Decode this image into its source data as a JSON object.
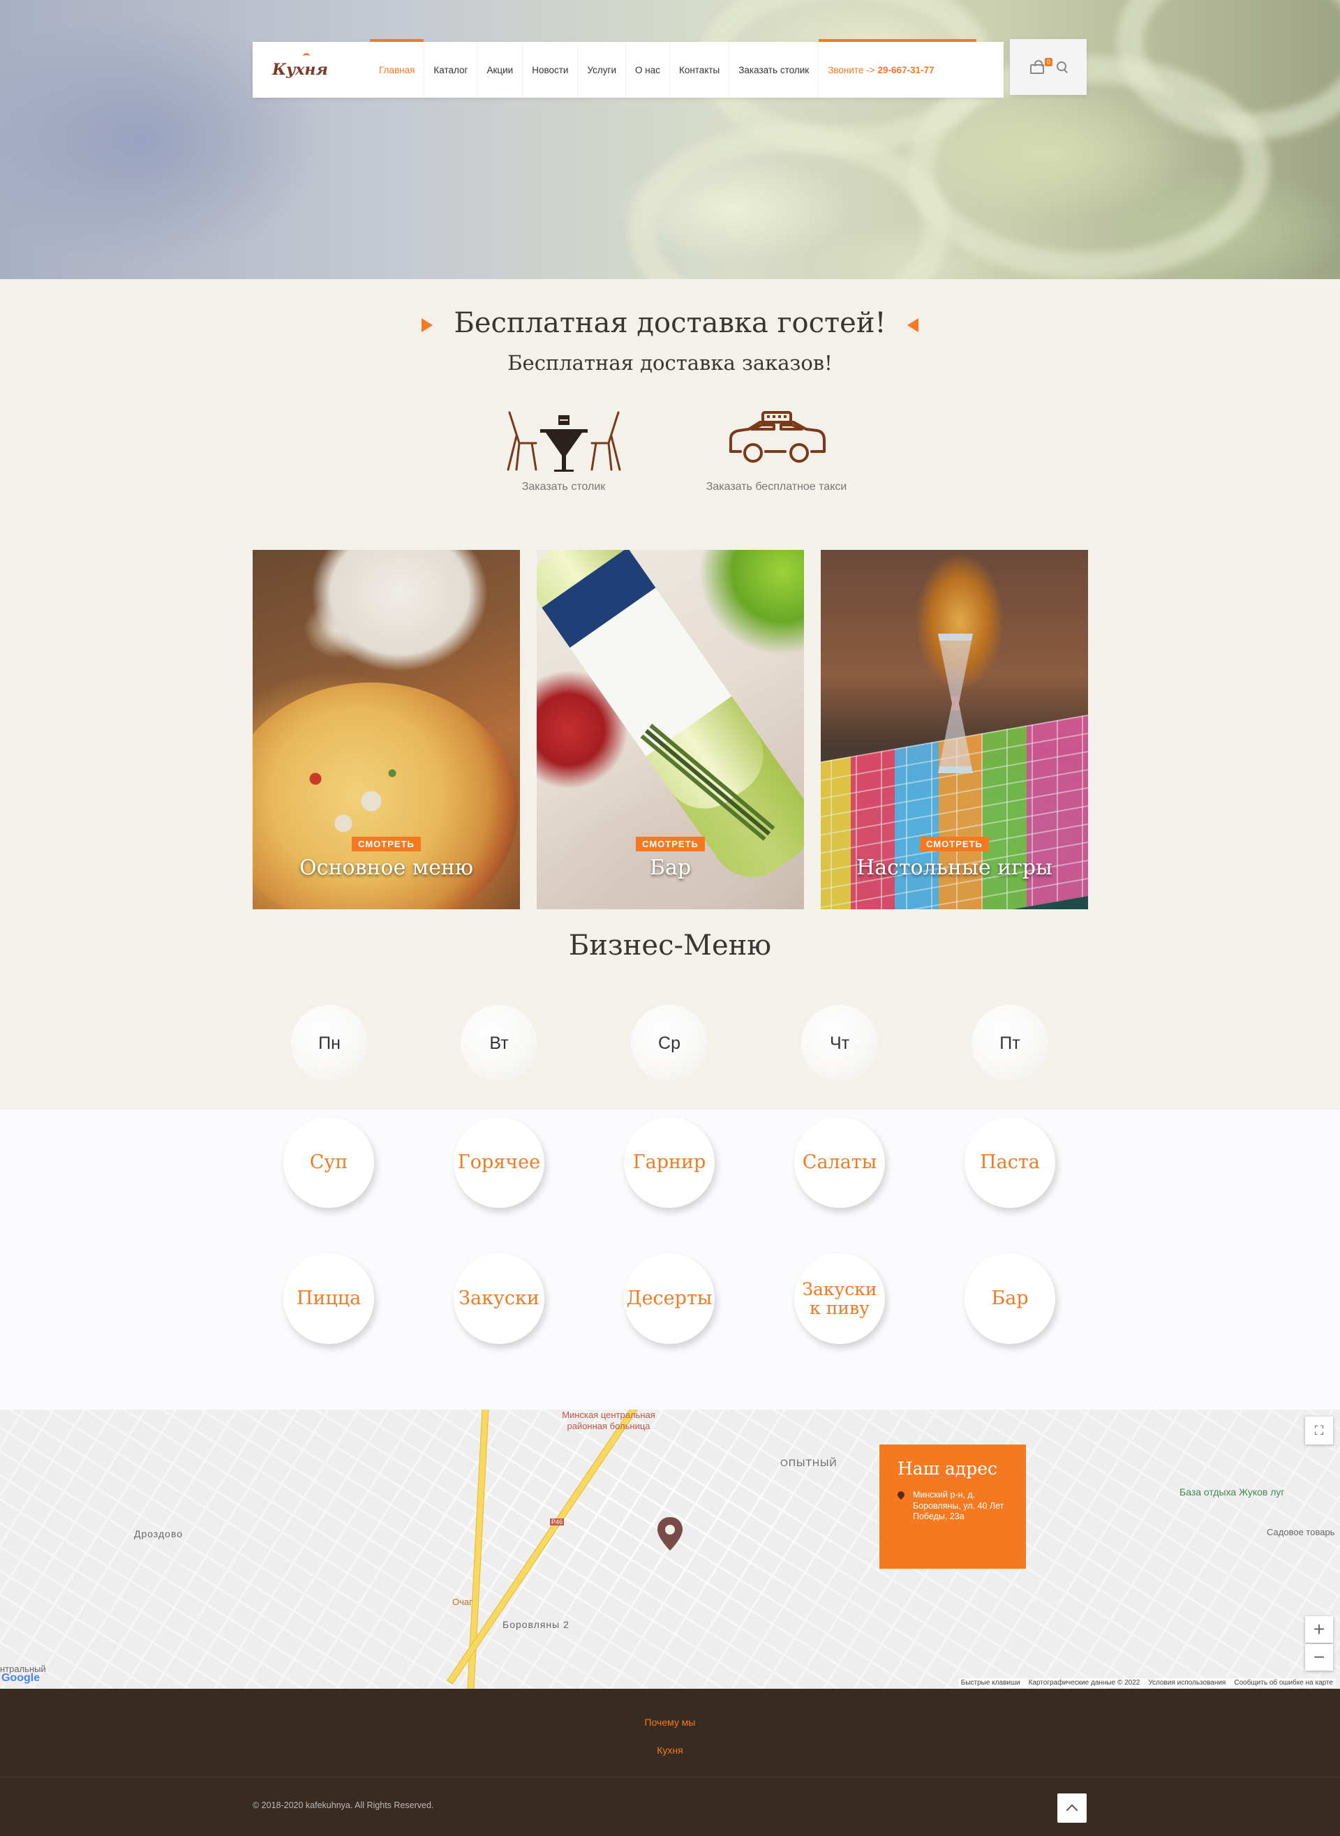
{
  "header": {
    "logo_text": "Кухня",
    "nav": [
      "Главная",
      "Каталог",
      "Акции",
      "Новости",
      "Услуги",
      "О нас",
      "Контакты",
      "Заказать столик"
    ],
    "phone_prefix": "Звоните ->",
    "phone": "29-667-31-77",
    "cart_count": "0"
  },
  "delivery": {
    "title": "Бесплатная доставка гостей!",
    "subtitle": "Бесплатная доставка заказов!",
    "features": [
      {
        "label": "Заказать столик",
        "icon": "table-chairs-icon"
      },
      {
        "label": "Заказать бесплатное такси",
        "icon": "taxi-icon"
      }
    ]
  },
  "categories": [
    {
      "button": "Смотреть",
      "title": "Основное меню"
    },
    {
      "button": "Смотреть",
      "title": "Бар"
    },
    {
      "button": "Смотреть",
      "title": "Настольные игры"
    }
  ],
  "business_menu": {
    "title": "Бизнес-Меню",
    "days": [
      "Пн",
      "Вт",
      "Ср",
      "Чт",
      "Пт"
    ],
    "dishes": [
      "Суп",
      "Горячее",
      "Гарнир",
      "Салаты",
      "Паста",
      "Пицца",
      "Закуски",
      "Десерты",
      "Закуски к пиву",
      "Бар"
    ]
  },
  "map": {
    "labels": {
      "hospital": "Минская центральная районная больница",
      "opytny": "ОПЫТНЫЙ",
      "drozdovo": "Дроздово",
      "ochag": "Очаг",
      "borovlyany2": "Боровляны 2",
      "baza": "База отдыха Жуков луг",
      "sadovoe": "Садовое товарь",
      "road": "Р46",
      "left_edge": "нтральный"
    },
    "address_title": "Наш адрес",
    "address_text": "Минский р-н, д. Боровляны, ул. 40 Лет Победы, 23а",
    "attribution": [
      "Быстрые клавиши",
      "Картографические данные © 2022",
      "Условия использования",
      "Сообщить об ошибке на карте"
    ],
    "google": "Google"
  },
  "footer": {
    "links": [
      "Почему мы",
      "Кухня"
    ],
    "copyright": "© 2018-2020 kafekuhnya. All Rights Reserved."
  },
  "colors": {
    "accent": "#f47920",
    "footer_bg": "#382b21",
    "page_bg": "#f3f1ea",
    "dark_brown": "#5a2a12"
  }
}
